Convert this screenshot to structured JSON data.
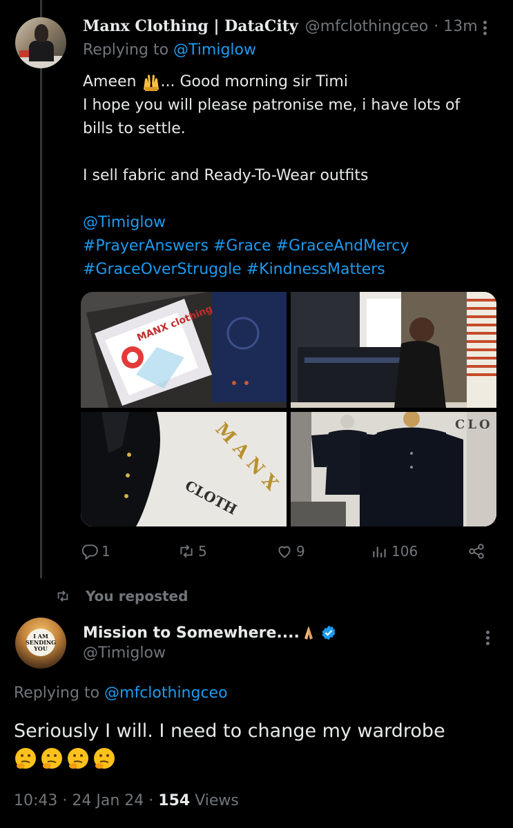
{
  "tweet1": {
    "author_name": "Manx Clothing | DataCity",
    "handle": "@mfclothingceo",
    "time": "· 13m",
    "replying_prefix": "Replying to",
    "replying_handle": "@Timiglow",
    "line1_a": "Ameen",
    "line1_b": "... Good morning sir Timi",
    "line2": "I hope you will please patronise me, i have lots of",
    "line3": "bills to settle.",
    "line4": "I sell fabric and Ready-To-Wear outfits",
    "mention": "@Timiglow",
    "hashtags_line1": "#PrayerAnswers #Grace #GraceAndMercy",
    "hashtags_line2": "#GraceOverStruggle #KindnessMatters",
    "media": {
      "photo1_text": "MANX clothing",
      "photo3_text_a": "M A N X",
      "photo3_text_b": "CLOTH",
      "photo4_text": "CLO"
    },
    "counts": {
      "replies": "1",
      "reposts": "5",
      "likes": "9",
      "views": "106"
    }
  },
  "repost_label": "You reposted",
  "tweet2": {
    "author_name": "Mission to Somewhere....",
    "handle": "@Timiglow",
    "avatar_text": "I AM SENDING YOU",
    "replying_prefix": "Replying to",
    "replying_handle": "@mfclothingceo",
    "text": "Seriously I will. I need to change my wardrobe",
    "time": "10:43 · 24 Jan 24 ·",
    "views_count": "154",
    "views_label": "Views"
  },
  "colors": {
    "background": "#000000",
    "text": "#e7e9ea",
    "muted": "#71767b",
    "link": "#1d9bf0",
    "verified": "#1d9bf0"
  }
}
